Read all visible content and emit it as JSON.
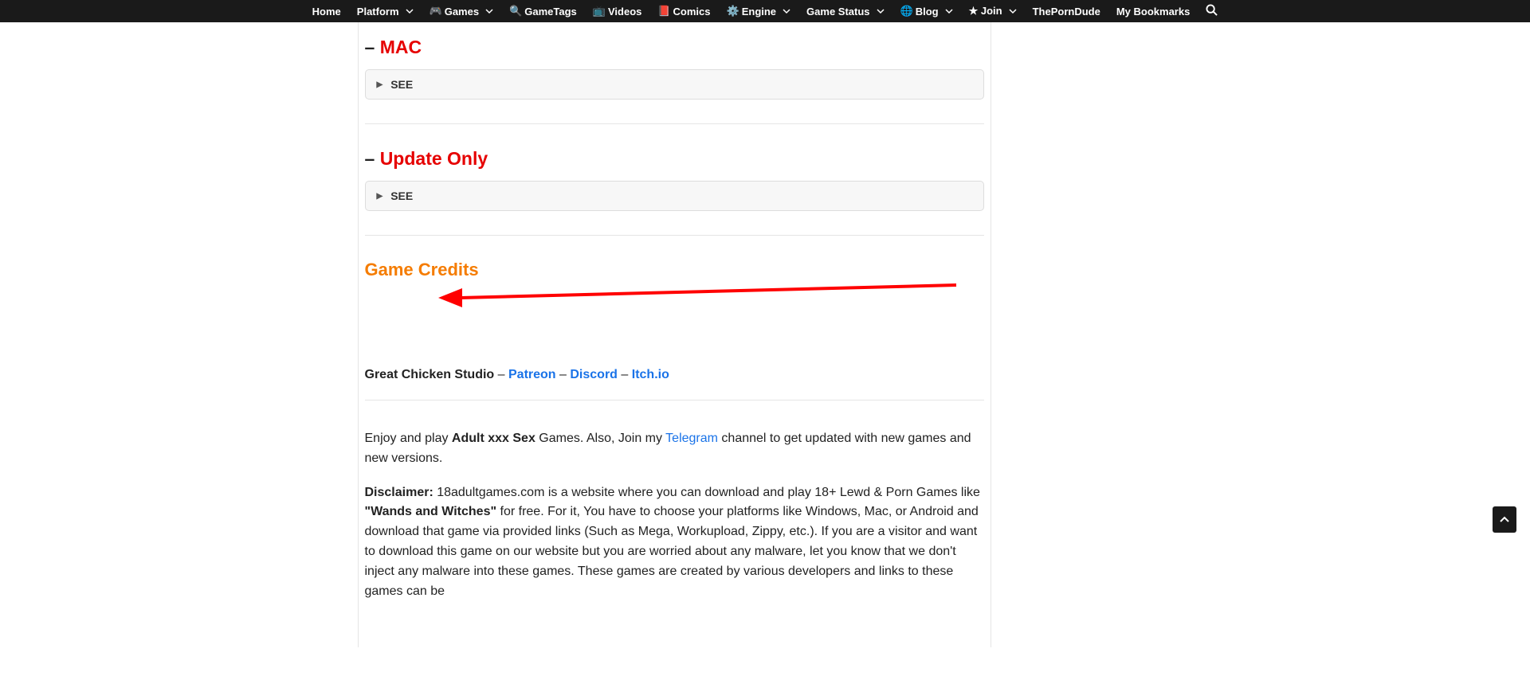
{
  "navbar": {
    "items": [
      {
        "label": "Home",
        "hasIcon": false,
        "hasChevron": false
      },
      {
        "label": "Platform",
        "hasIcon": false,
        "hasChevron": true
      },
      {
        "label": "Games",
        "hasIcon": true,
        "icon": "🎮",
        "hasChevron": true
      },
      {
        "label": "GameTags",
        "hasIcon": true,
        "icon": "🔍",
        "hasChevron": false
      },
      {
        "label": "Videos",
        "hasIcon": true,
        "icon": "📺",
        "hasChevron": false
      },
      {
        "label": "Comics",
        "hasIcon": true,
        "icon": "📕",
        "hasChevron": false
      },
      {
        "label": "Engine",
        "hasIcon": true,
        "icon": "⚙️",
        "hasChevron": true
      },
      {
        "label": "Game Status",
        "hasIcon": false,
        "hasChevron": true
      },
      {
        "label": "Blog",
        "hasIcon": true,
        "icon": "🌐",
        "hasChevron": true
      },
      {
        "label": "★ Join",
        "hasIcon": false,
        "hasChevron": true
      },
      {
        "label": "ThePornDude",
        "hasIcon": false,
        "hasChevron": false
      },
      {
        "label": "My Bookmarks",
        "hasIcon": false,
        "hasChevron": false
      }
    ]
  },
  "sections": {
    "mac": {
      "dash": "–",
      "title": "MAC",
      "see": "SEE"
    },
    "update": {
      "dash": "–",
      "title": "Update Only",
      "see": "SEE"
    },
    "credits": {
      "title": "Game Credits"
    }
  },
  "credits": {
    "studio": "Great Chicken Studio",
    "sep1": " – ",
    "link1": "Patreon",
    "sep2": " – ",
    "link2": "Discord",
    "sep3": " – ",
    "link3": "Itch.io"
  },
  "enjoy": {
    "prefix": "Enjoy and play ",
    "bold": "Adult xxx Sex",
    "mid": " Games. Also, Join my ",
    "link": "Telegram",
    "suffix": " channel to get updated with new games and new versions."
  },
  "disclaimer": {
    "label": "Disclaimer:",
    "text1": " 18adultgames.com is a website where you can download and play 18+ Lewd & Porn Games like ",
    "quoted": "\"Wands and Witches\"",
    "text2": " for free. For it, You have to choose your platforms like Windows, Mac, or Android and download that game via provided links (Such as Mega, Workupload, Zippy, etc.). If you are a visitor and want to download this game on our website but you are worried about any malware, let you know that we don't inject any malware into these games. These games are created by various developers and links to these games can be"
  }
}
